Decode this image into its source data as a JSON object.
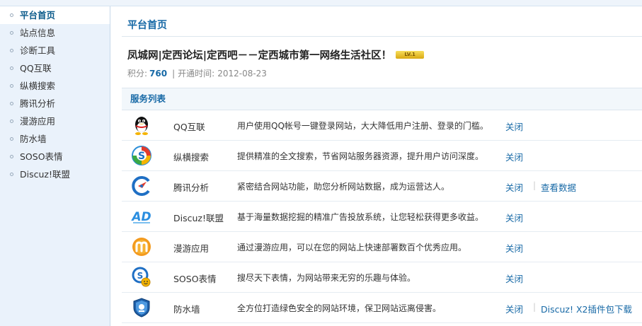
{
  "sidebar": {
    "items": [
      {
        "label": "平台首页"
      },
      {
        "label": "站点信息"
      },
      {
        "label": "诊断工具"
      },
      {
        "label": "QQ互联"
      },
      {
        "label": "纵横搜索"
      },
      {
        "label": "腾讯分析"
      },
      {
        "label": "漫游应用"
      },
      {
        "label": "防水墙"
      },
      {
        "label": "SOSO表情"
      },
      {
        "label": "Discuz!联盟"
      }
    ]
  },
  "main": {
    "title": "平台首页",
    "site_name": "凤城网|定西论坛|定西吧－－定西城市第一网络生活社区！",
    "badge": "LV.1",
    "points_label": "积分:",
    "points": "760",
    "separator": "|",
    "open_label": "开通时间:",
    "open_date": "2012-08-23"
  },
  "services": {
    "header": "服务列表",
    "rows": [
      {
        "icon": "qq-penguin-icon",
        "name": "QQ互联",
        "desc": "用户使用QQ帐号一键登录网站，大大降低用户注册、登录的门槛。",
        "action": "关闭",
        "extra": ""
      },
      {
        "icon": "soso-search-icon",
        "name": "纵横搜索",
        "desc": "提供精准的全文搜索，节省网站服务器资源，提升用户访问深度。",
        "action": "关闭",
        "extra": ""
      },
      {
        "icon": "tencent-analytics-icon",
        "name": "腾讯分析",
        "desc": "紧密结合网站功能，助您分析网站数据，成为运营达人。",
        "action": "关闭",
        "extra": "查看数据"
      },
      {
        "icon": "ad-icon",
        "name": "Discuz!联盟",
        "desc": "基于海量数据挖掘的精准广告投放系统，让您轻松获得更多收益。",
        "action": "关闭",
        "extra": ""
      },
      {
        "icon": "manyou-icon",
        "name": "漫游应用",
        "desc": "通过漫游应用，可以在您的网站上快速部署数百个优秀应用。",
        "action": "关闭",
        "extra": ""
      },
      {
        "icon": "soso-emoticon-icon",
        "name": "SOSO表情",
        "desc": "搜尽天下表情，为网站带来无穷的乐趣与体验。",
        "action": "关闭",
        "extra": ""
      },
      {
        "icon": "firewall-shield-icon",
        "name": "防水墙",
        "desc": "全方位打造绿色安全的网站环境，保卫网站远离侵害。",
        "action": "关闭",
        "extra": "Discuz! X2插件包下载"
      }
    ]
  }
}
